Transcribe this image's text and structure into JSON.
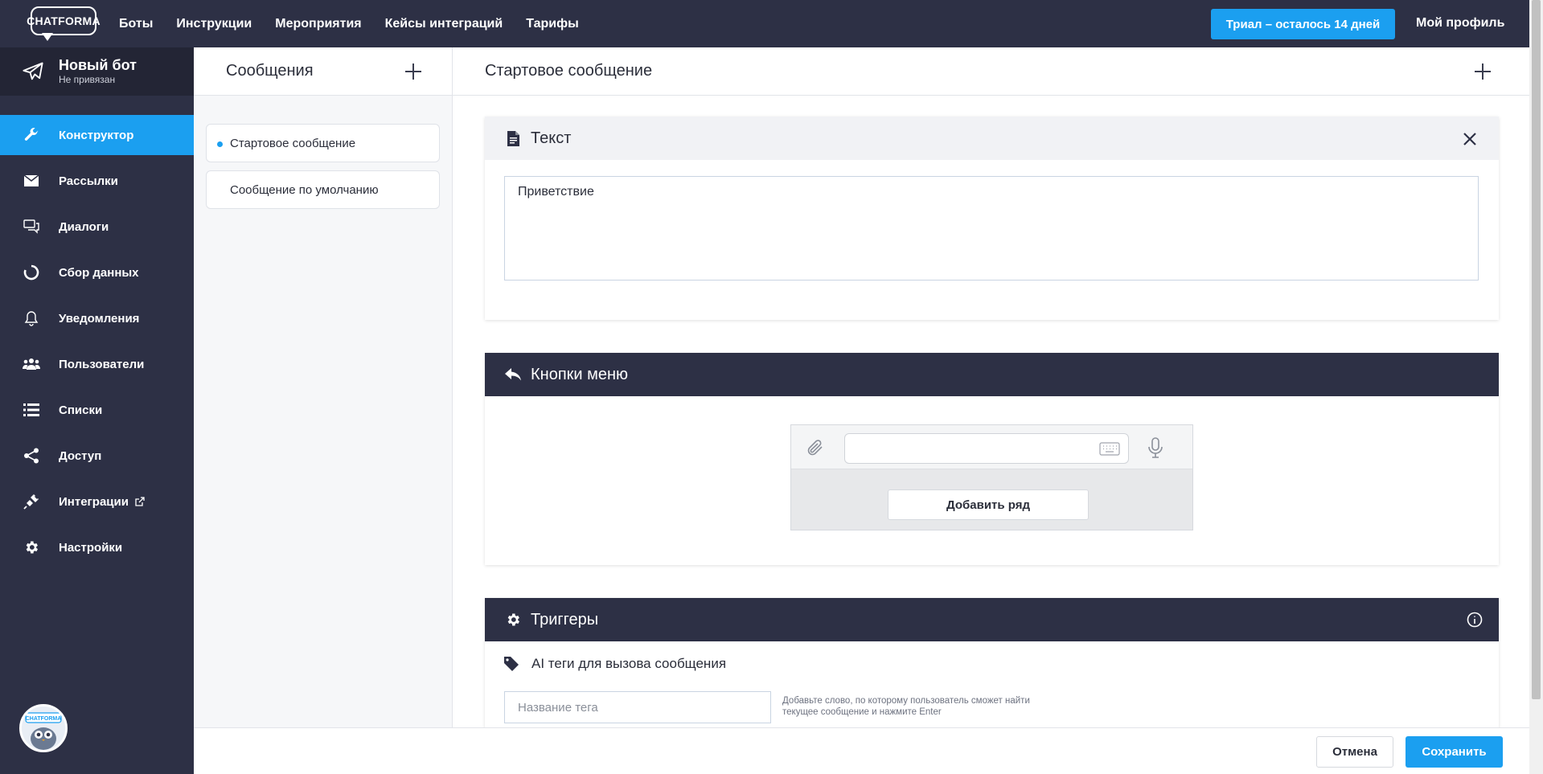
{
  "topbar": {
    "logo_text": "CHATFORMA",
    "nav": [
      "Боты",
      "Инструкции",
      "Мероприятия",
      "Кейсы интеграций",
      "Тарифы"
    ],
    "trial_label": "Триал – осталось 14 дней",
    "profile_label": "Мой профиль"
  },
  "sidebar": {
    "bot_name": "Новый бот",
    "bot_status": "Не привязан",
    "items": [
      {
        "label": "Конструктор",
        "icon": "wrench-icon",
        "active": true
      },
      {
        "label": "Рассылки",
        "icon": "envelope-icon"
      },
      {
        "label": "Диалоги",
        "icon": "chat-icon"
      },
      {
        "label": "Сбор данных",
        "icon": "circle-progress-icon"
      },
      {
        "label": "Уведомления",
        "icon": "bell-icon"
      },
      {
        "label": "Пользователи",
        "icon": "users-icon"
      },
      {
        "label": "Списки",
        "icon": "list-icon"
      },
      {
        "label": "Доступ",
        "icon": "share-icon"
      },
      {
        "label": "Интеграции",
        "icon": "plug-icon"
      },
      {
        "label": "Настройки",
        "icon": "gear-icon"
      }
    ],
    "avatar_text": "CHATFORMA"
  },
  "messages": {
    "title": "Сообщения",
    "items": [
      "Стартовое сообщение",
      "Сообщение по умолчанию"
    ]
  },
  "main": {
    "title": "Стартовое сообщение",
    "text_card": {
      "title": "Текст",
      "value": "Приветствие"
    },
    "menu_card": {
      "title": "Кнопки меню",
      "add_row_label": "Добавить ряд"
    },
    "triggers_card": {
      "title": "Триггеры",
      "tags_label": "AI теги для вызова сообщения",
      "tag_placeholder": "Название тега",
      "tag_hint": "Добавьте слово, по которому пользователь сможет найти текущее сообщение и нажмите Enter"
    }
  },
  "footer": {
    "cancel_label": "Отмена",
    "save_label": "Сохранить"
  },
  "colors": {
    "accent": "#1b9ff0",
    "dark": "#2d3045"
  }
}
